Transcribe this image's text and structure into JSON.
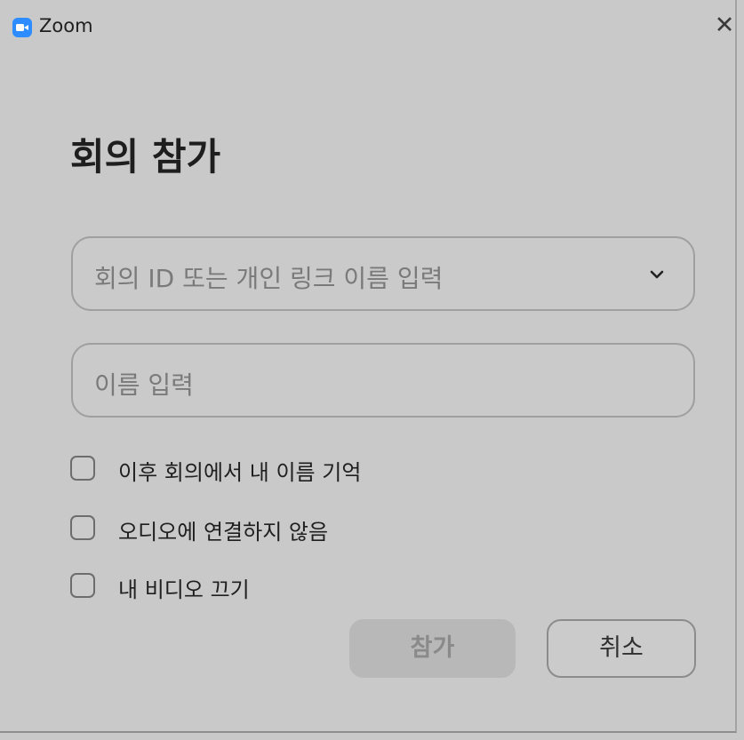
{
  "window": {
    "title": "Zoom",
    "close_glyph": "✕",
    "app_icon": "zoom-camera-icon"
  },
  "dialog": {
    "heading": "회의 참가",
    "meeting_id": {
      "placeholder": "회의 ID 또는 개인 링크 이름 입력",
      "value": "",
      "dropdown_icon": "chevron-down-icon"
    },
    "name": {
      "placeholder": "이름 입력",
      "value": ""
    },
    "options": [
      {
        "label": "이후 회의에서 내 이름 기억",
        "checked": false
      },
      {
        "label": "오디오에 연결하지 않음",
        "checked": false
      },
      {
        "label": "내 비디오 끄기",
        "checked": false
      }
    ],
    "join_label": "참가",
    "cancel_label": "취소"
  }
}
